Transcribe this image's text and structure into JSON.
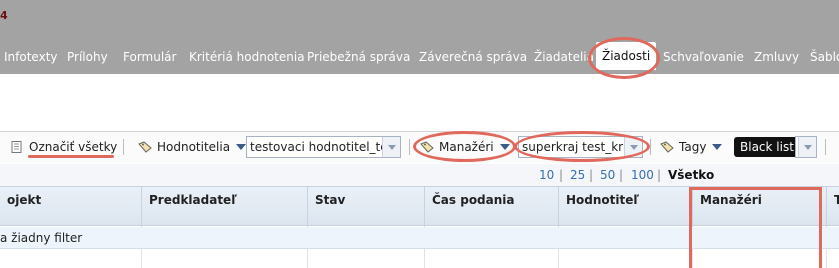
{
  "header": {
    "fragment": "4"
  },
  "tabs": [
    "Infotexty",
    "Prílohy",
    "Formulár",
    "Kritériá hodnotenia",
    "Priebežná správa",
    "Záverečná správa",
    "Žiadatelia",
    "Žiadosti",
    "Schvaľovanie",
    "Zmluvy",
    "Šablóny"
  ],
  "active_tab": "Žiadosti",
  "toolbar": {
    "select_all": "Označiť všetky",
    "reviewers": "Hodnotitelia",
    "reviewer_value": "testovaci hodnotitel_test",
    "managers": "Manažéri",
    "manager_value": "superkraj test_kraj",
    "tags": "Tagy",
    "blacklist": "Black list"
  },
  "paging": {
    "sizes": [
      "10",
      "25",
      "50",
      "100"
    ],
    "all": "Všetko",
    "separator": "|"
  },
  "table": {
    "columns": [
      "ojekt",
      "Predkladateľ",
      "Stav",
      "Čas podania",
      "Hodnotiteľ",
      "Manažéri",
      "T"
    ],
    "filter_text": "a žiadny filter"
  },
  "colors": {
    "annotation": "#e0685c",
    "topbar": "#a3a3a3",
    "link": "#3a6fb0"
  },
  "icons": [
    "document-icon",
    "tag-icon",
    "dropdown-icon"
  ]
}
